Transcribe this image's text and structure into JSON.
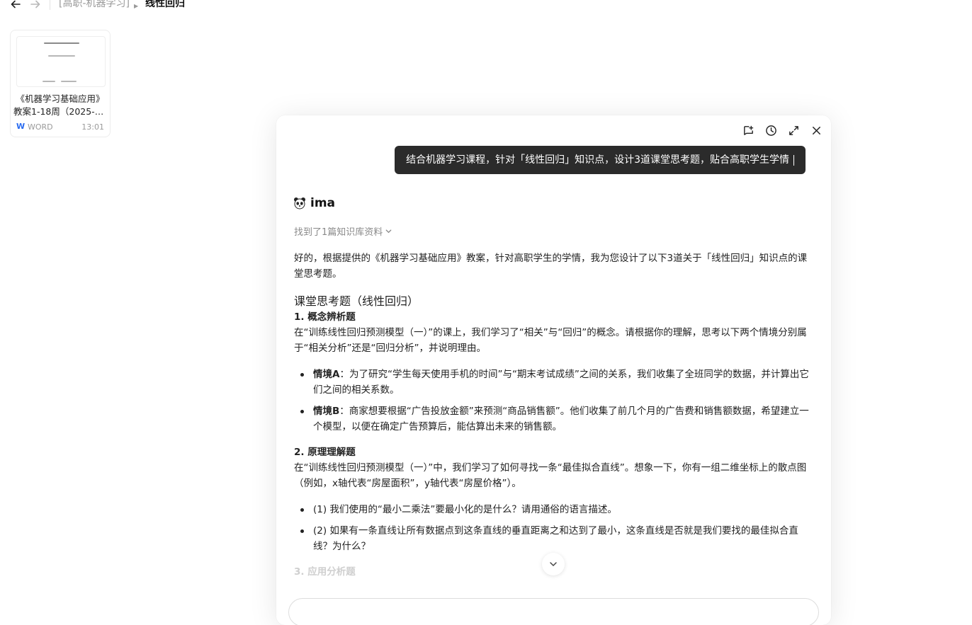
{
  "breadcrumb": {
    "parent": "[高职-机器学习]",
    "current": "线性回归"
  },
  "file_card": {
    "title_line1": "《机器学习基础应用》",
    "title_line2": "教案1-18周（2025-2...",
    "type": "WORD",
    "time": "13:01"
  },
  "chat": {
    "user_message": "结合机器学习课程，针对「线性回归」知识点，设计3道课堂思考题，贴合高职学生学情",
    "assistant_name": "ima",
    "kb_found": "找到了1篇知识库资料",
    "intro": "好的，根据提供的《机器学习基础应用》教案，针对高职学生的学情，我为您设计了以下3道关于「线性回归」知识点的课堂思考题。",
    "section_title": "课堂思考题（线性回归）",
    "q1": {
      "title": "1. 概念辨析题",
      "body": "在“训练线性回归预测模型（一）”的课上，我们学习了“相关”与“回归”的概念。请根据你的理解，思考以下两个情境分别属于“相关分析”还是“回归分析”，并说明理由。",
      "bullets": [
        {
          "label": "情境A",
          "text": "：为了研究“学生每天使用手机的时间”与“期末考试成绩”之间的关系，我们收集了全班同学的数据，并计算出它们之间的相关系数。"
        },
        {
          "label": "情境B",
          "text": "：商家想要根据“广告投放金额”来预测“商品销售额”。他们收集了前几个月的广告费和销售额数据，希望建立一个模型，以便在确定广告预算后，能估算出未来的销售额。"
        }
      ]
    },
    "q2": {
      "title": "2. 原理理解题",
      "body": "在“训练线性回归预测模型（一）”中，我们学习了如何寻找一条“最佳拟合直线”。想象一下，你有一组二维坐标上的散点图（例如，x轴代表“房屋面积”，y轴代表“房屋价格”）。",
      "bullets": [
        {
          "text": "(1) 我们使用的“最小二乘法”要最小化的是什么？请用通俗的语言描述。"
        },
        {
          "text": "(2) 如果有一条直线让所有数据点到这条直线的垂直距离之和达到了最小，这条直线是否就是我们要找的最佳拟合直线？为什么？"
        }
      ]
    },
    "q3_partial": "3. 应用分析题"
  },
  "icons": [
    "back-arrow-icon",
    "forward-arrow-icon",
    "word-icon",
    "add-note-icon",
    "history-icon",
    "expand-icon",
    "close-icon",
    "panda-icon",
    "chevron-down-icon"
  ]
}
